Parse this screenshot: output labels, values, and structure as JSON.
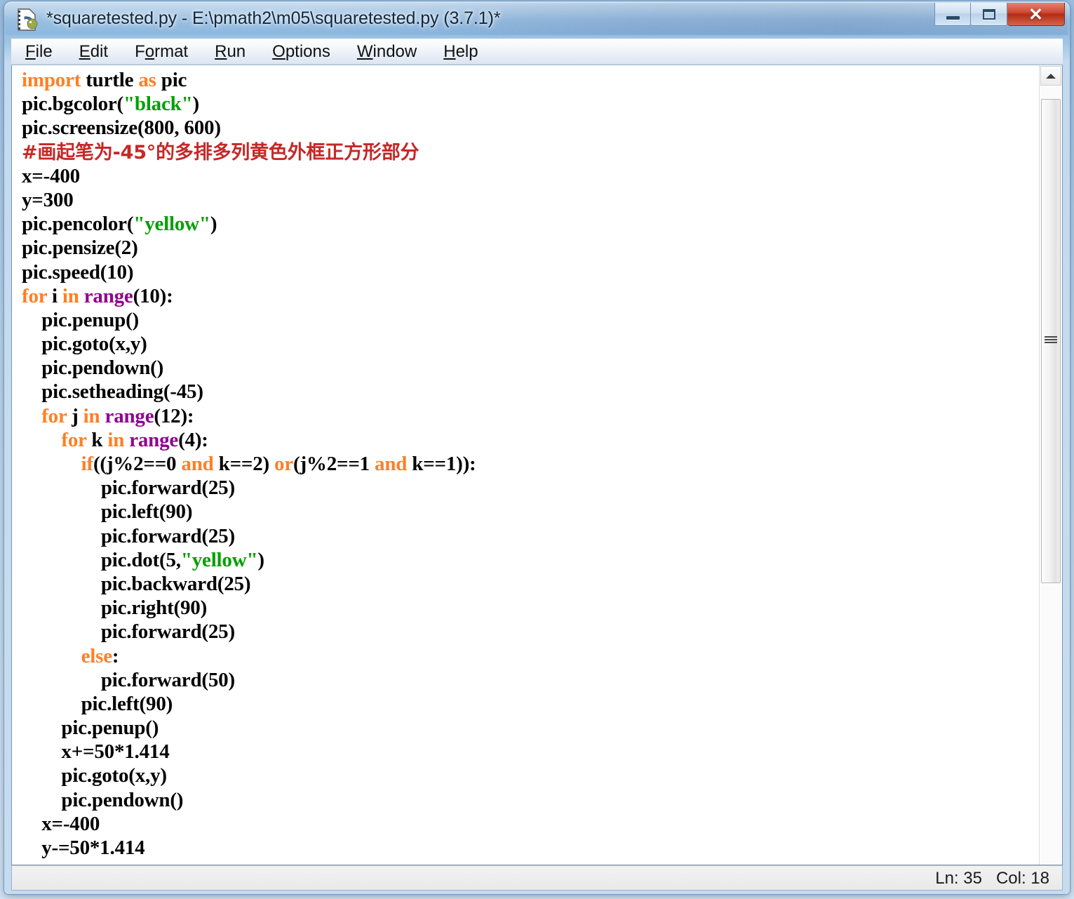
{
  "window": {
    "title": "*squaretested.py - E:\\pmath2\\m05\\squaretested.py (3.7.1)*",
    "icon": "python-idle-file-icon",
    "controls": {
      "minimize": "minimize-icon",
      "maximize": "maximize-icon",
      "close": "✕"
    }
  },
  "menubar": {
    "items": [
      {
        "accel": "F",
        "rest": "ile"
      },
      {
        "accel": "E",
        "rest": "dit"
      },
      {
        "accel": "F",
        "rest": "o",
        "accel2": "",
        "label": "Format"
      },
      {
        "accel": "R",
        "rest": "un"
      },
      {
        "accel": "O",
        "rest": "ptions"
      },
      {
        "accel": "W",
        "rest": "indow"
      },
      {
        "accel": "H",
        "rest": "elp"
      }
    ],
    "labels": {
      "file_pre": "F",
      "file_post": "ile",
      "edit_pre": "E",
      "edit_post": "dit",
      "format_a": "F",
      "format_b": "o",
      "format_c": "rmat",
      "run_pre": "R",
      "run_post": "un",
      "options_pre": "O",
      "options_post": "ptions",
      "window_pre": "W",
      "window_post": "indow",
      "help_pre": "H",
      "help_post": "elp"
    }
  },
  "editor": {
    "colors": {
      "keyword": "#ff7f24",
      "builtin": "#900090",
      "string": "#00a000",
      "comment": "#c62828",
      "text": "#000000",
      "background": "#ffffff"
    },
    "lines": [
      {
        "n": 1,
        "indent": 0,
        "tokens": [
          {
            "t": "import",
            "c": "kw"
          },
          {
            "t": " turtle ",
            "c": ""
          },
          {
            "t": "as",
            "c": "kw"
          },
          {
            "t": " pic",
            "c": ""
          }
        ]
      },
      {
        "n": 2,
        "indent": 0,
        "tokens": [
          {
            "t": "pic.bgcolor(",
            "c": ""
          },
          {
            "t": "\"black\"",
            "c": "str"
          },
          {
            "t": ")",
            "c": ""
          }
        ]
      },
      {
        "n": 3,
        "indent": 0,
        "tokens": [
          {
            "t": "pic.screensize(800, 600)",
            "c": ""
          }
        ]
      },
      {
        "n": 4,
        "indent": 0,
        "tokens": [
          {
            "t": "#画起笔为-45°的多排多列黄色外框正方形部分",
            "c": "cmt cmt-cjk"
          }
        ]
      },
      {
        "n": 5,
        "indent": 0,
        "tokens": [
          {
            "t": "x=-400",
            "c": ""
          }
        ]
      },
      {
        "n": 6,
        "indent": 0,
        "tokens": [
          {
            "t": "y=300",
            "c": ""
          }
        ]
      },
      {
        "n": 7,
        "indent": 0,
        "tokens": [
          {
            "t": "pic.pencolor(",
            "c": ""
          },
          {
            "t": "\"yellow\"",
            "c": "str"
          },
          {
            "t": ")",
            "c": ""
          }
        ]
      },
      {
        "n": 8,
        "indent": 0,
        "tokens": [
          {
            "t": "pic.pensize(2)",
            "c": ""
          }
        ]
      },
      {
        "n": 9,
        "indent": 0,
        "tokens": [
          {
            "t": "pic.speed(10)",
            "c": ""
          }
        ]
      },
      {
        "n": 10,
        "indent": 0,
        "tokens": [
          {
            "t": "for",
            "c": "kw"
          },
          {
            "t": " i ",
            "c": ""
          },
          {
            "t": "in",
            "c": "kw"
          },
          {
            "t": " ",
            "c": ""
          },
          {
            "t": "range",
            "c": "bi"
          },
          {
            "t": "(10):",
            "c": ""
          }
        ]
      },
      {
        "n": 11,
        "indent": 1,
        "tokens": [
          {
            "t": "pic.penup()",
            "c": ""
          }
        ]
      },
      {
        "n": 12,
        "indent": 1,
        "tokens": [
          {
            "t": "pic.goto(x,y)",
            "c": ""
          }
        ]
      },
      {
        "n": 13,
        "indent": 1,
        "tokens": [
          {
            "t": "pic.pendown()",
            "c": ""
          }
        ]
      },
      {
        "n": 14,
        "indent": 1,
        "tokens": [
          {
            "t": "pic.setheading(-45)",
            "c": ""
          }
        ]
      },
      {
        "n": 15,
        "indent": 1,
        "tokens": [
          {
            "t": "for",
            "c": "kw"
          },
          {
            "t": " j ",
            "c": ""
          },
          {
            "t": "in",
            "c": "kw"
          },
          {
            "t": " ",
            "c": ""
          },
          {
            "t": "range",
            "c": "bi"
          },
          {
            "t": "(12):",
            "c": ""
          }
        ]
      },
      {
        "n": 16,
        "indent": 2,
        "tokens": [
          {
            "t": "for",
            "c": "kw"
          },
          {
            "t": " k ",
            "c": ""
          },
          {
            "t": "in",
            "c": "kw"
          },
          {
            "t": " ",
            "c": ""
          },
          {
            "t": "range",
            "c": "bi"
          },
          {
            "t": "(4):",
            "c": ""
          }
        ]
      },
      {
        "n": 17,
        "indent": 3,
        "tokens": [
          {
            "t": "if",
            "c": "kw"
          },
          {
            "t": "((j%2==0 ",
            "c": ""
          },
          {
            "t": "and",
            "c": "kw"
          },
          {
            "t": " k==2) ",
            "c": ""
          },
          {
            "t": "or",
            "c": "kw"
          },
          {
            "t": "(j%2==1 ",
            "c": ""
          },
          {
            "t": "and",
            "c": "kw"
          },
          {
            "t": " k==1)):",
            "c": ""
          }
        ]
      },
      {
        "n": 18,
        "indent": 4,
        "tokens": [
          {
            "t": "pic.forward(25)",
            "c": ""
          }
        ]
      },
      {
        "n": 19,
        "indent": 4,
        "tokens": [
          {
            "t": "pic.left(90)",
            "c": ""
          }
        ]
      },
      {
        "n": 20,
        "indent": 4,
        "tokens": [
          {
            "t": "pic.forward(25)",
            "c": ""
          }
        ]
      },
      {
        "n": 21,
        "indent": 4,
        "tokens": [
          {
            "t": "pic.dot(5,",
            "c": ""
          },
          {
            "t": "\"yellow\"",
            "c": "str"
          },
          {
            "t": ")",
            "c": ""
          }
        ]
      },
      {
        "n": 22,
        "indent": 4,
        "tokens": [
          {
            "t": "pic.backward(25)",
            "c": ""
          }
        ]
      },
      {
        "n": 23,
        "indent": 4,
        "tokens": [
          {
            "t": "pic.right(90)",
            "c": ""
          }
        ]
      },
      {
        "n": 24,
        "indent": 4,
        "tokens": [
          {
            "t": "pic.forward(25)",
            "c": ""
          }
        ]
      },
      {
        "n": 25,
        "indent": 3,
        "tokens": [
          {
            "t": "else",
            "c": "kw"
          },
          {
            "t": ":",
            "c": ""
          }
        ]
      },
      {
        "n": 26,
        "indent": 4,
        "tokens": [
          {
            "t": "pic.forward(50)",
            "c": ""
          }
        ]
      },
      {
        "n": 27,
        "indent": 3,
        "tokens": [
          {
            "t": "pic.left(90)",
            "c": ""
          }
        ]
      },
      {
        "n": 28,
        "indent": 2,
        "tokens": [
          {
            "t": "pic.penup()",
            "c": ""
          }
        ]
      },
      {
        "n": 29,
        "indent": 2,
        "tokens": [
          {
            "t": "x+=50*1.414",
            "c": ""
          }
        ]
      },
      {
        "n": 30,
        "indent": 2,
        "tokens": [
          {
            "t": "pic.goto(x,y)",
            "c": ""
          }
        ]
      },
      {
        "n": 31,
        "indent": 2,
        "tokens": [
          {
            "t": "pic.pendown()",
            "c": ""
          }
        ]
      },
      {
        "n": 32,
        "indent": 1,
        "tokens": [
          {
            "t": "x=-400",
            "c": ""
          }
        ]
      },
      {
        "n": 33,
        "indent": 1,
        "tokens": [
          {
            "t": "y-=50*1.414",
            "c": ""
          }
        ]
      }
    ]
  },
  "scrollbar": {
    "up_arrow": "triangle-up-icon",
    "thumb_grip": "grip-lines-icon"
  },
  "statusbar": {
    "position": "Ln: 35   Col: 18",
    "line": "35",
    "column": "18"
  }
}
